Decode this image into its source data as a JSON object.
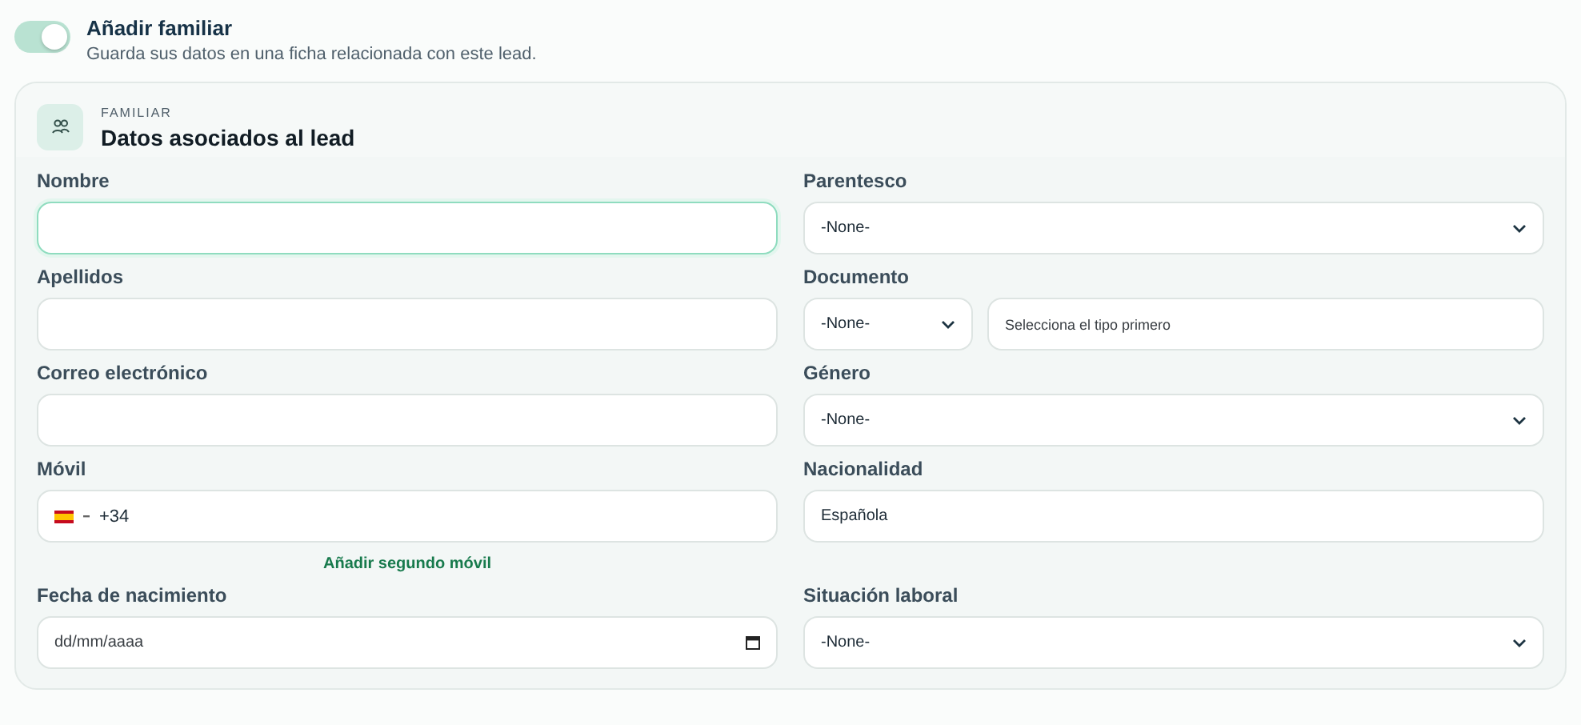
{
  "toggle": {
    "label": "Añadir familiar",
    "description": "Guarda sus datos en una ficha relacionada con este lead.",
    "on": true
  },
  "section": {
    "eyebrow": "FAMILIAR",
    "title": "Datos asociados al lead"
  },
  "rows": [
    {
      "left": {
        "kind": "text",
        "label": "Nombre",
        "focused": true
      },
      "right": {
        "kind": "select",
        "label": "Parentesco",
        "value": "-None-"
      }
    },
    {
      "left": {
        "kind": "text",
        "label": "Apellidos",
        "focused": false
      },
      "right": {
        "kind": "document",
        "label": "Documento",
        "value": "-None-",
        "placeholder": "Selecciona el tipo primero"
      }
    },
    {
      "left": {
        "kind": "text",
        "label": "Correo electrónico",
        "focused": false
      },
      "right": {
        "kind": "select",
        "label": "Género",
        "value": "-None-"
      }
    },
    {
      "left": {
        "kind": "phone",
        "label": "Móvil",
        "code": "+34",
        "link": "Añadir segundo móvil"
      },
      "right": {
        "kind": "text",
        "label": "Nacionalidad",
        "value": "Española",
        "focused": false
      }
    },
    {
      "left": {
        "kind": "date",
        "label": "Fecha de nacimiento",
        "placeholder": "dd/mm/aaaa"
      },
      "right": {
        "kind": "select",
        "label": "Situación laboral",
        "value": "-None-"
      }
    }
  ]
}
